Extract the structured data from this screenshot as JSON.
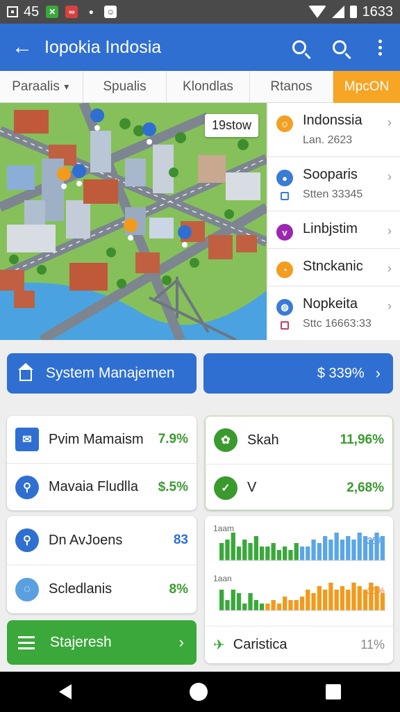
{
  "status_bar": {
    "left_text": "45",
    "time": "1633"
  },
  "app_bar": {
    "title": "Iopokia Indosia",
    "back_icon": "arrow-left-icon",
    "actions": [
      "search-icon",
      "search-icon",
      "more-vert-icon"
    ]
  },
  "tabs": [
    {
      "label": "Paraalis",
      "has_dropdown": true
    },
    {
      "label": "Spualis"
    },
    {
      "label": "Klondlas"
    },
    {
      "label": "Rtanos"
    },
    {
      "label": "MpcON",
      "active": true
    }
  ],
  "map": {
    "tag": "19stow"
  },
  "side_list": [
    {
      "title": "Indonssia",
      "subtitle": "Lan. 2623",
      "icon": "smile-icon",
      "color": "#f2a023"
    },
    {
      "title": "Sooparis",
      "subtitle": "Stten 33345",
      "icon": "person-icon",
      "color": "#3a7bd5"
    },
    {
      "title": "Linbjstim",
      "subtitle": "",
      "icon": "chevron-v-icon",
      "color": "#9c27b0"
    },
    {
      "title": "Stnckanic",
      "subtitle": "",
      "icon": "pie-icon",
      "color": "#f39c1f"
    },
    {
      "title": "Nopkeita",
      "subtitle": "Sttc 16663:33",
      "icon": "globe-icon",
      "color": "#3a7bd5"
    }
  ],
  "actions": {
    "system_label": "System Manajemen",
    "pct_label": "$ 339%"
  },
  "cards": {
    "left_top": [
      {
        "label": "Pvim Mamaism",
        "value": "7.9%",
        "icon": "mail-icon",
        "color": "#2f6fd1"
      },
      {
        "label": "Mavaia Fludlla",
        "value": "$.5%",
        "icon": "location-icon",
        "color": "#2f6fd1"
      }
    ],
    "right_top": [
      {
        "label": "Skah",
        "value": "11,96%",
        "icon": "user-badge-icon",
        "color": "#3a9a2e"
      },
      {
        "label": "V",
        "value": "2,68%",
        "icon": "check-icon",
        "color": "#3a9a2e"
      }
    ],
    "left_mid": [
      {
        "label": "Dn AvJoens",
        "value": "83",
        "icon": "search-icon",
        "color": "#2f6fd1"
      },
      {
        "label": "Scledlanis",
        "value": "8%",
        "icon": "chat-icon",
        "color": "#5aa0e0"
      }
    ]
  },
  "stat_button": {
    "label": "Stajeresh"
  },
  "chart_data": [
    {
      "type": "bar",
      "title": "1aam",
      "annotation": ".35%",
      "values": [
        5,
        6,
        8,
        4,
        6,
        5,
        7,
        4,
        4,
        5,
        3,
        4,
        3,
        5,
        4,
        4,
        6,
        5,
        7,
        6,
        8,
        6,
        7,
        6,
        8,
        7,
        6,
        8,
        7
      ],
      "colors": [
        "#3aa83a",
        "#3aa83a",
        "#3aa83a",
        "#3aa83a",
        "#3aa83a",
        "#3aa83a",
        "#3aa83a",
        "#3aa83a",
        "#3aa83a",
        "#3aa83a",
        "#3aa83a",
        "#3aa83a",
        "#3aa83a",
        "#3aa83a",
        "#5aa6e6",
        "#5aa6e6",
        "#5aa6e6",
        "#5aa6e6",
        "#5aa6e6",
        "#5aa6e6",
        "#5aa6e6",
        "#5aa6e6",
        "#5aa6e6",
        "#5aa6e6",
        "#5aa6e6",
        "#5aa6e6",
        "#5aa6e6",
        "#5aa6e6",
        "#5aa6e6"
      ],
      "annotation_color": "#3a7bd5"
    },
    {
      "type": "bar",
      "title": "1aan",
      "annotation": ".35%",
      "values": [
        6,
        3,
        6,
        5,
        2,
        5,
        3,
        2,
        2,
        3,
        2,
        4,
        3,
        3,
        4,
        6,
        5,
        7,
        6,
        8,
        6,
        7,
        6,
        8,
        7,
        6,
        8,
        7,
        5
      ],
      "colors": [
        "#3aa83a",
        "#3aa83a",
        "#3aa83a",
        "#3aa83a",
        "#3aa83a",
        "#3aa83a",
        "#3aa83a",
        "#3aa83a",
        "#f29a1c",
        "#f29a1c",
        "#f29a1c",
        "#f29a1c",
        "#f29a1c",
        "#f29a1c",
        "#f29a1c",
        "#f29a1c",
        "#f29a1c",
        "#f29a1c",
        "#f29a1c",
        "#f29a1c",
        "#f29a1c",
        "#f29a1c",
        "#f29a1c",
        "#f29a1c",
        "#f29a1c",
        "#f29a1c",
        "#f29a1c",
        "#f29a1c",
        "#f29a1c"
      ],
      "annotation_color": "#e8702a"
    }
  ],
  "chart_footer": {
    "label": "Caristica",
    "value": "11%",
    "icon": "plane-icon"
  }
}
